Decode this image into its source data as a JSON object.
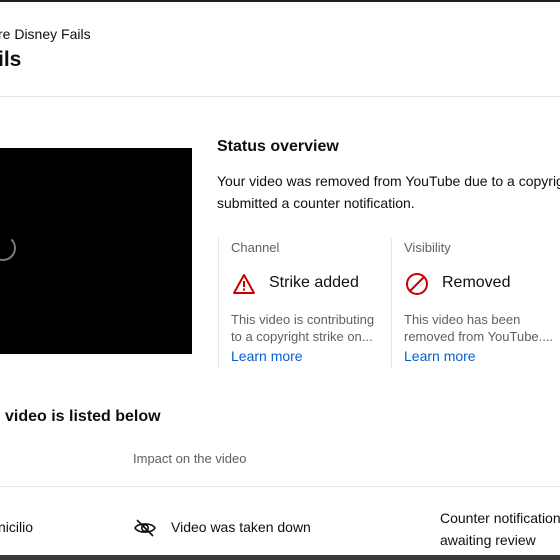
{
  "header": {
    "subtitle": "re Disney Fails",
    "title": "ils"
  },
  "status": {
    "heading": "Status overview",
    "description_line1": "Your video was removed from YouTube due to a copyrig",
    "description_line2": "submitted a counter notification."
  },
  "cards": {
    "channel": {
      "label": "Channel",
      "icon": "warning-triangle-icon",
      "value": "Strike added",
      "desc_line1": "This video is contributing",
      "desc_line2": "to a copyright strike on...",
      "link": "Learn more"
    },
    "visibility": {
      "label": "Visibility",
      "icon": "removed-circle-icon",
      "value": "Removed",
      "desc_line1": "This video has been",
      "desc_line2": "removed from YouTube....",
      "link": "Learn more"
    }
  },
  "list": {
    "heading": "video is listed below",
    "column_impact": "Impact on the video",
    "row": {
      "owner": "nicilio",
      "impact_icon": "eye-off-icon",
      "impact": "Video was taken down",
      "status_line1": "Counter notification",
      "status_line2": "awaiting review"
    }
  },
  "colors": {
    "link": "#065fd4",
    "alert": "#cc0000",
    "muted": "#606060"
  }
}
